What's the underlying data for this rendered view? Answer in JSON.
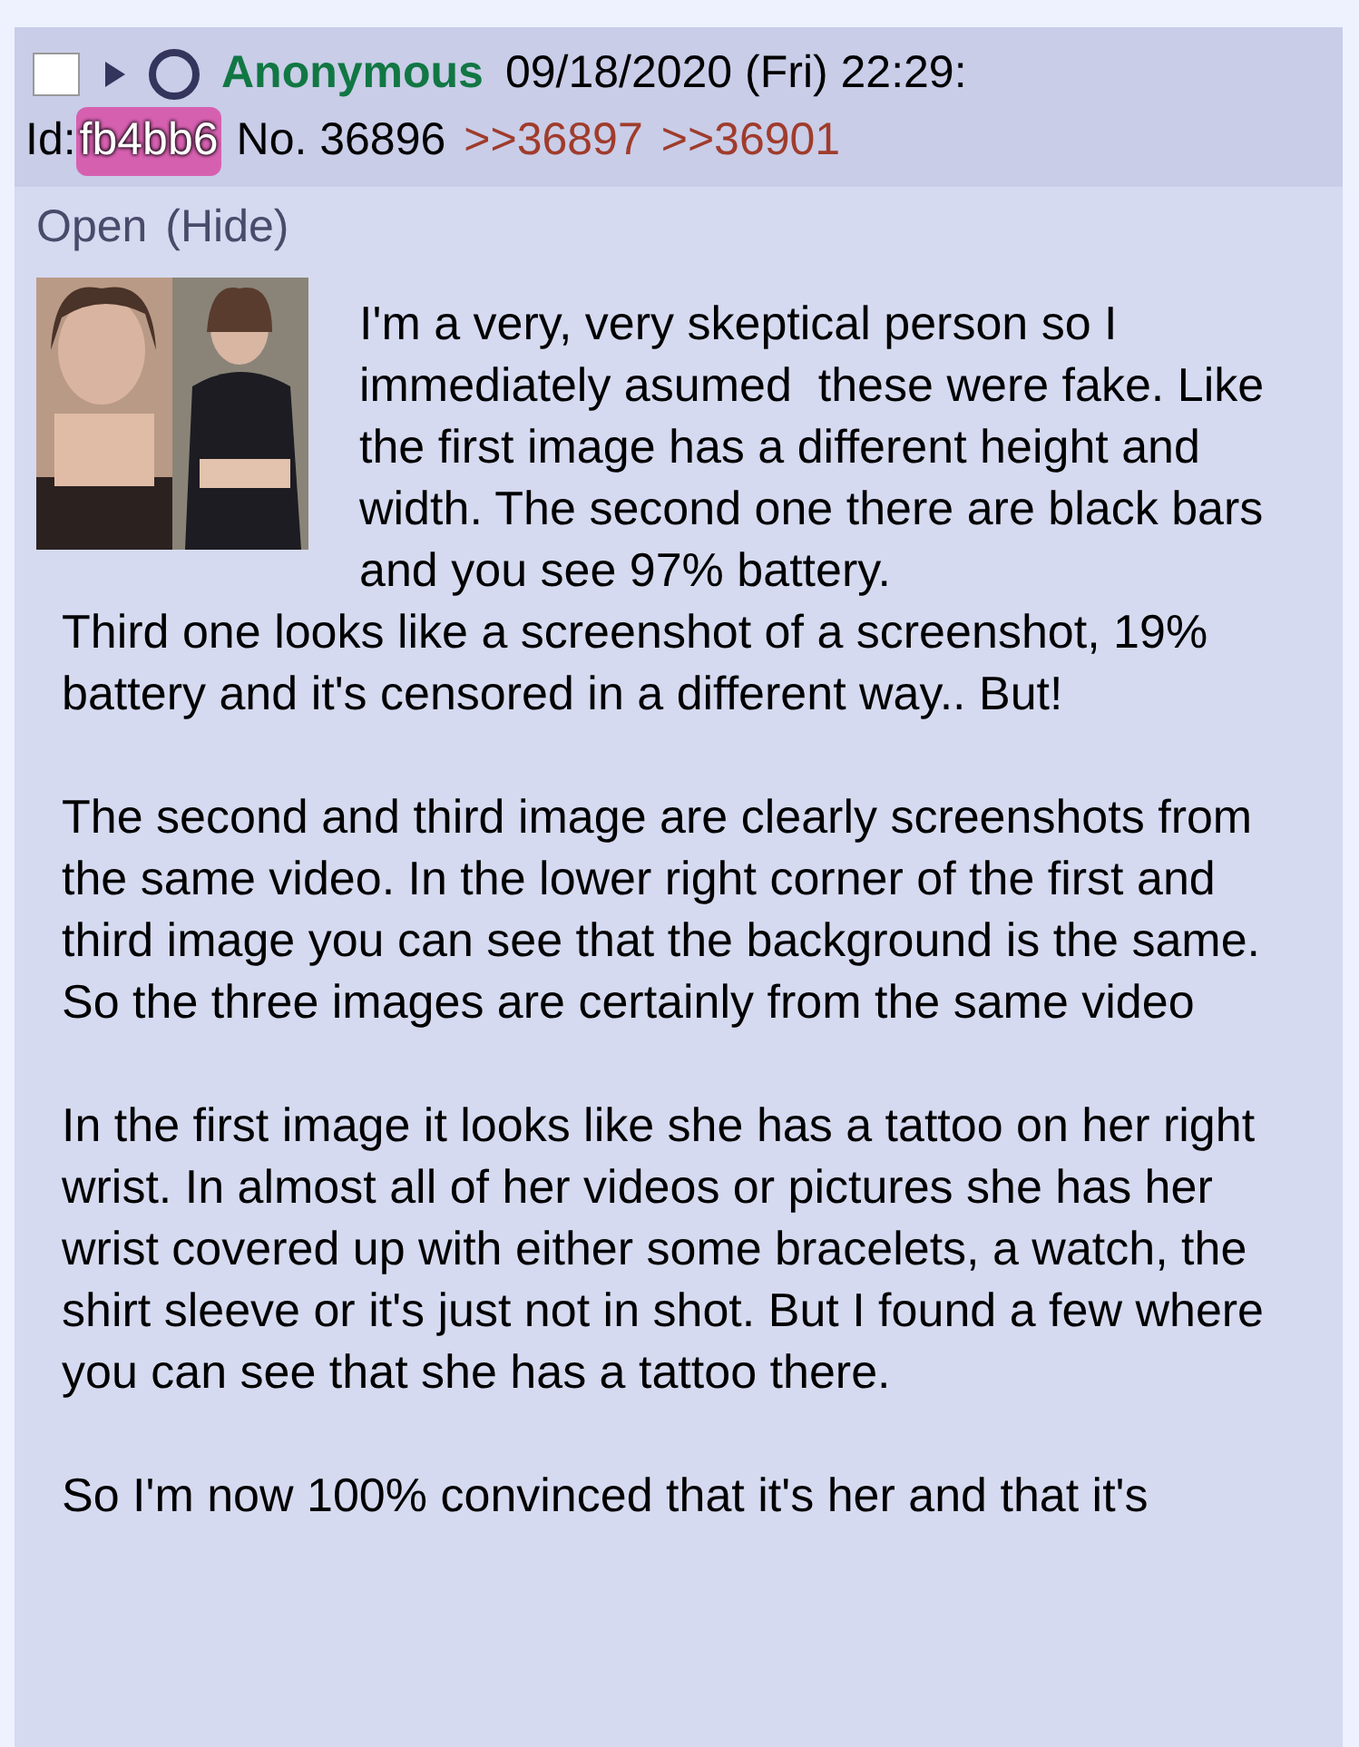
{
  "post": {
    "checked": false,
    "name": "Anonymous",
    "datetime": "09/18/2020 (Fri) 22:29:",
    "id_label": "Id:",
    "id": "fb4bb6",
    "number": "No. 36896",
    "replies": [
      ">>36897",
      ">>36901"
    ],
    "actions": [
      "Open",
      "(Hide)"
    ],
    "paragraphs": [
      "I'm a very, very skeptical person so I immediately asumed  these were fake. Like the first image has a different height and width. The second one there are black bars and you see 97% battery.",
      "Third one looks like a screenshot of a screenshot, 19% battery and it's censored in a different way.. But!",
      "The second and third image are clearly screenshots from the same video. In the lower right corner of the first and third image you can see that the background is the same. So the three images are certainly from the same video",
      "In the first image it looks like she has a tattoo on her right wrist. In almost all of her videos or pictures she has her wrist covered up with either some bracelets, a watch, the shirt sleeve or it's just not in shot. But I found a few where you can see that she has a tattoo there.",
      "So I'm now 100% convinced that it's her and that it's"
    ]
  }
}
